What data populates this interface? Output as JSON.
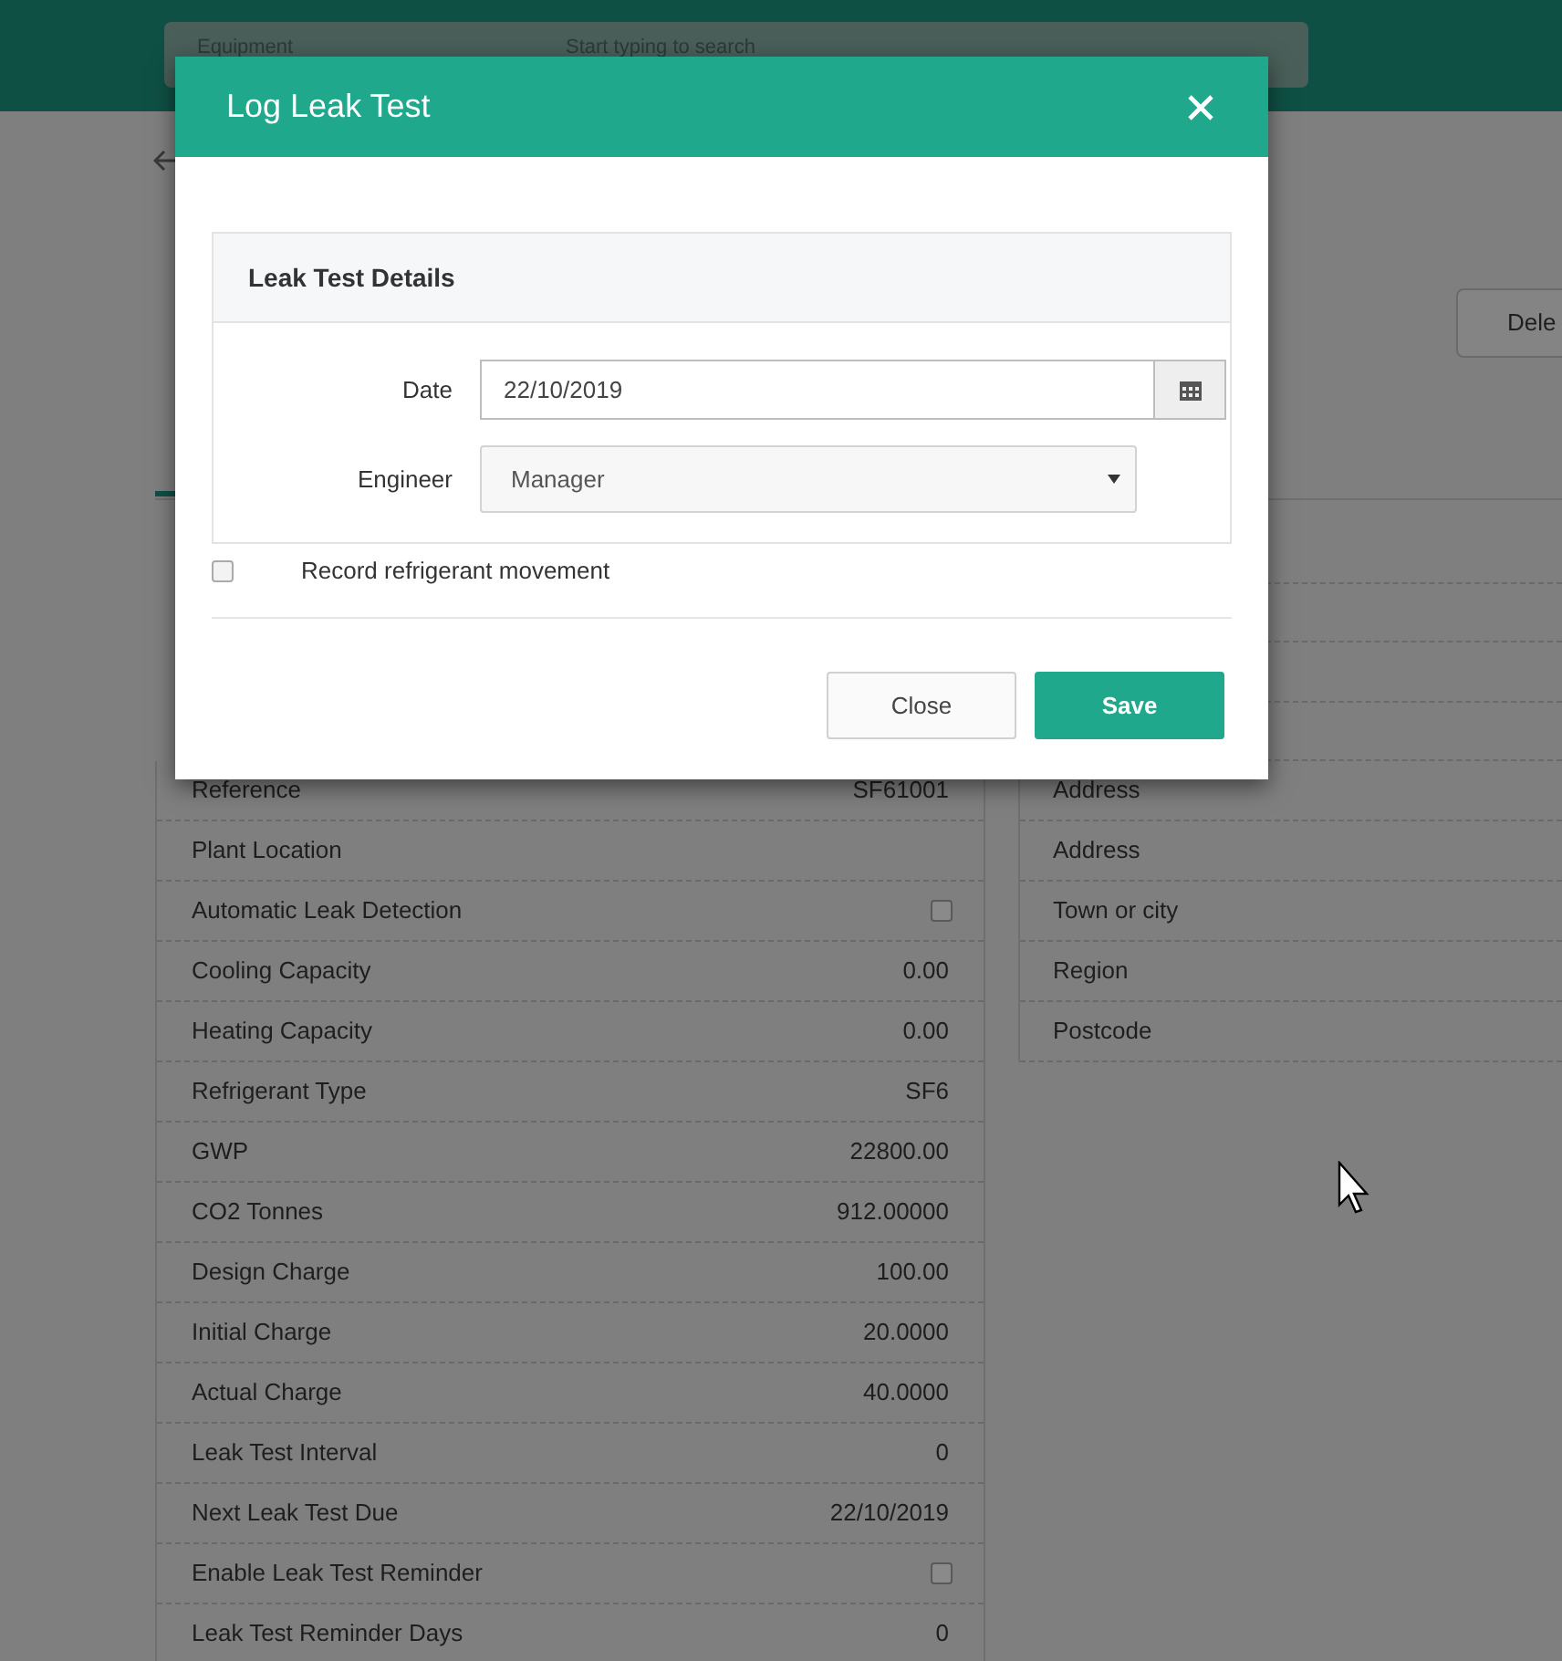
{
  "header": {
    "search_scope": "Equipment",
    "search_placeholder": "Start typing to search"
  },
  "page": {
    "delete_button": "Dele",
    "details": [
      {
        "kind": "text",
        "label": "Reference",
        "value": "SF61001"
      },
      {
        "kind": "text",
        "label": "Plant Location"
      },
      {
        "kind": "checkbox",
        "label": "Automatic Leak Detection",
        "checked": false
      },
      {
        "kind": "text",
        "label": "Cooling Capacity",
        "value": "0.00"
      },
      {
        "kind": "text",
        "label": "Heating Capacity",
        "value": "0.00"
      },
      {
        "kind": "text",
        "label": "Refrigerant Type",
        "value": "SF6"
      },
      {
        "kind": "text",
        "label": "GWP",
        "value": "22800.00"
      },
      {
        "kind": "text",
        "label": "CO2 Tonnes",
        "value": "912.00000"
      },
      {
        "kind": "text",
        "label": "Design Charge",
        "value": "100.00"
      },
      {
        "kind": "text",
        "label": "Initial Charge",
        "value": "20.0000"
      },
      {
        "kind": "text",
        "label": "Actual Charge",
        "value": "40.0000"
      },
      {
        "kind": "text",
        "label": "Leak Test Interval",
        "value": "0"
      },
      {
        "kind": "text",
        "label": "Next Leak Test Due",
        "value": "22/10/2019"
      },
      {
        "kind": "checkbox",
        "label": "Enable Leak Test Reminder",
        "checked": false
      },
      {
        "kind": "text",
        "label": "Leak Test Reminder Days",
        "value": "0"
      }
    ],
    "address": [
      "Address",
      "Address",
      "Town or city",
      "Region",
      "Postcode"
    ]
  },
  "modal": {
    "title": "Log Leak Test",
    "section_title": "Leak Test Details",
    "date": {
      "label": "Date",
      "value": "22/10/2019"
    },
    "engineer": {
      "label": "Engineer",
      "value": "Manager"
    },
    "record_movement": {
      "label": "Record refrigerant movement",
      "checked": false
    },
    "buttons": [
      {
        "label": "Close",
        "kind": "secondary"
      },
      {
        "label": "Save",
        "kind": "primary"
      }
    ]
  }
}
